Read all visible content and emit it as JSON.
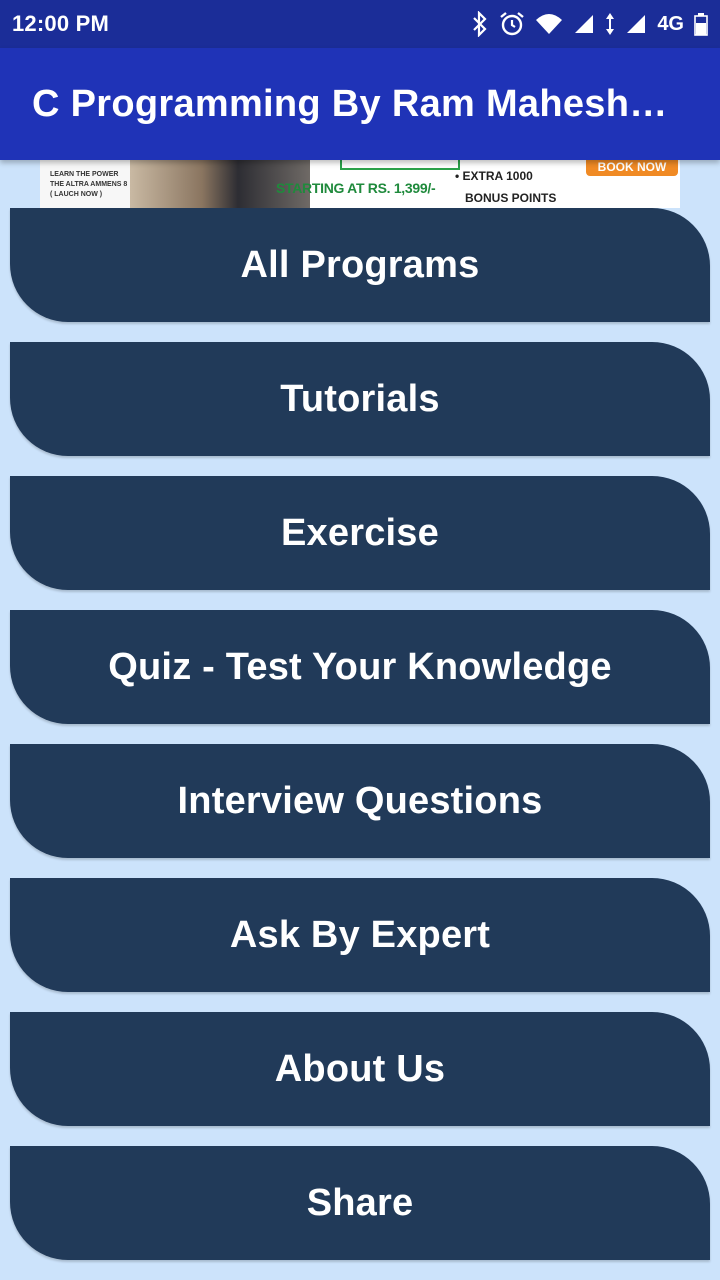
{
  "status_bar": {
    "time": "12:00 PM",
    "network": "4G",
    "icons": [
      "bluetooth-icon",
      "alarm-icon",
      "wifi-icon",
      "signal-icon",
      "data-arrows-icon",
      "signal-icon",
      "battery-icon"
    ]
  },
  "app_bar": {
    "title": "C Programming By Ram Maheshwari"
  },
  "ad": {
    "left_text": "LEARN THE POWER THE ALTRA AMMENS 8 ( LAUCH NOW )",
    "starting_text": "STARTING AT RS. 1,399/-",
    "extra_line1": "• EXTRA 1000",
    "extra_line2": "BONUS POINTS",
    "cta": "BOOK NOW"
  },
  "menu": {
    "items": [
      {
        "label": "All Programs"
      },
      {
        "label": "Tutorials"
      },
      {
        "label": "Exercise"
      },
      {
        "label": "Quiz - Test Your Knowledge"
      },
      {
        "label": "Interview Questions"
      },
      {
        "label": "Ask By Expert"
      },
      {
        "label": "About Us"
      },
      {
        "label": "Share"
      }
    ]
  },
  "colors": {
    "status_bar": "#1b2d98",
    "app_bar": "#1f33b7",
    "background": "#cce3fb",
    "button": "#213a59",
    "button_text": "#ffffff"
  }
}
